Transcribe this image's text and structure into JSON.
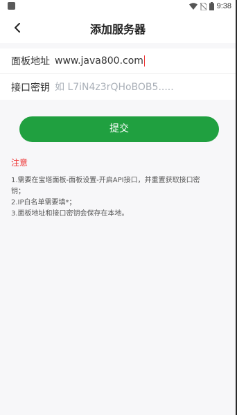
{
  "status_bar": {
    "time": "9:38"
  },
  "header": {
    "title": "添加服务器",
    "back_icon": "arrow-left-icon"
  },
  "form": {
    "panel_address": {
      "label": "面板地址",
      "value": "www.java800.com"
    },
    "api_key": {
      "label": "接口密钥",
      "placeholder": "如 L7iN4z3rQHoBOB5....."
    }
  },
  "submit": {
    "label": "提交",
    "color": "#20a040"
  },
  "notes": {
    "title": "注意",
    "title_color": "#ee3333",
    "lines": [
      "1.需要在宝塔面板-面板设置-开启API接口，并重置获取接口密",
      "钥；",
      "2.IP白名单需要填*；",
      "3.面板地址和接口密钥会保存在本地。"
    ]
  }
}
